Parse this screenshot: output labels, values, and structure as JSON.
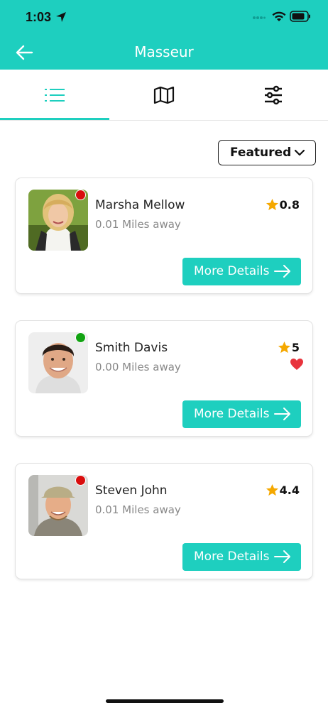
{
  "status_bar": {
    "time": "1:03"
  },
  "header": {
    "title": "Masseur",
    "back_icon": "arrow-left-icon"
  },
  "tabs": [
    {
      "name": "list",
      "icon": "list-icon",
      "active": true
    },
    {
      "name": "map",
      "icon": "map-icon",
      "active": false
    },
    {
      "name": "filters",
      "icon": "sliders-icon",
      "active": false
    }
  ],
  "sort": {
    "label": "Featured"
  },
  "colors": {
    "accent": "#1ecfbf",
    "offline": "#d90d0d",
    "online": "#12a312",
    "star": "#f5a800",
    "heart": "#e8333c"
  },
  "cards": [
    {
      "name": "Marsha Mellow",
      "distance": "0.01 Miles away",
      "rating": "0.8",
      "status": "offline",
      "favorite": false,
      "button": "More Details"
    },
    {
      "name": "Smith Davis",
      "distance": "0.00 Miles away",
      "rating": "5",
      "status": "online",
      "favorite": true,
      "button": "More Details"
    },
    {
      "name": "Steven John",
      "distance": "0.01 Miles away",
      "rating": "4.4",
      "status": "offline",
      "favorite": false,
      "button": "More Details"
    }
  ]
}
